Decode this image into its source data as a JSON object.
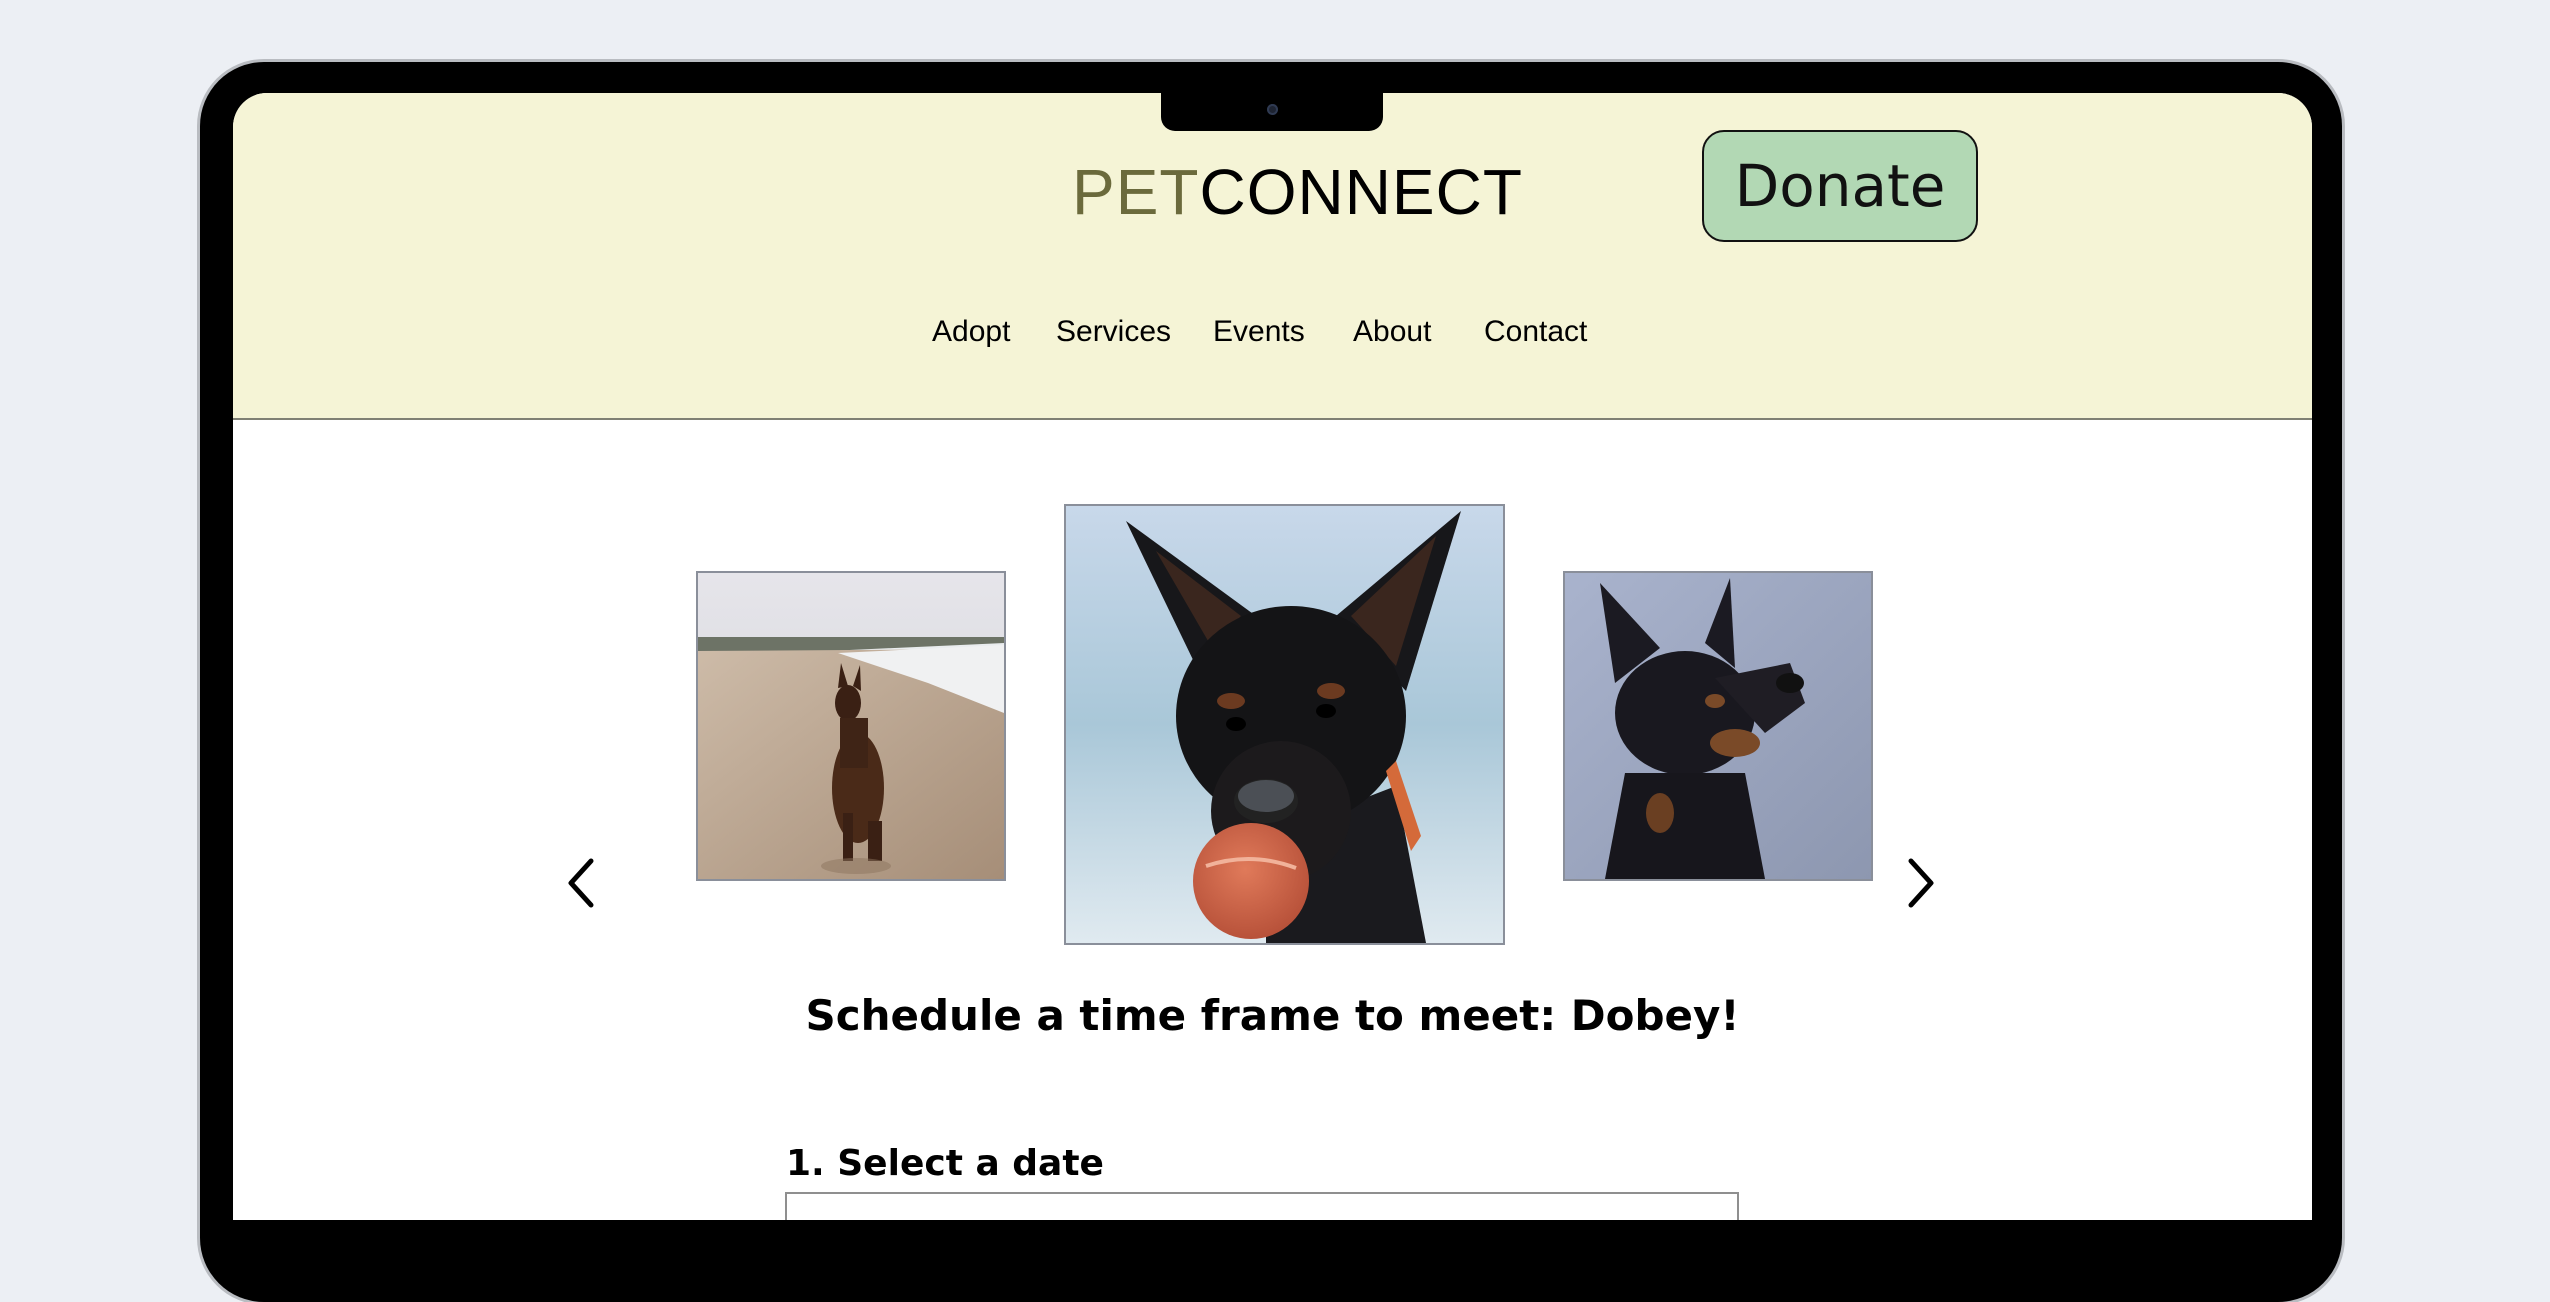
{
  "header": {
    "brand": {
      "prefix": "PET",
      "suffix": "CONNECT"
    },
    "donate_label": "Donate",
    "nav": [
      "Adopt",
      "Services",
      "Events",
      "About",
      "Contact"
    ]
  },
  "carousel": {
    "photos": [
      "doberman-on-beach",
      "doberman-with-ball",
      "doberman-looking-up"
    ],
    "prev_icon": "chevron-left-icon",
    "next_icon": "chevron-right-icon"
  },
  "schedule": {
    "heading": "Schedule a time frame to meet: Dobey!",
    "step1_label": "1. Select a date",
    "date_value": ""
  },
  "colors": {
    "header_bg": "#f5f4d6",
    "brand_accent": "#6b6a3c",
    "donate_bg": "#b2d8b4"
  }
}
